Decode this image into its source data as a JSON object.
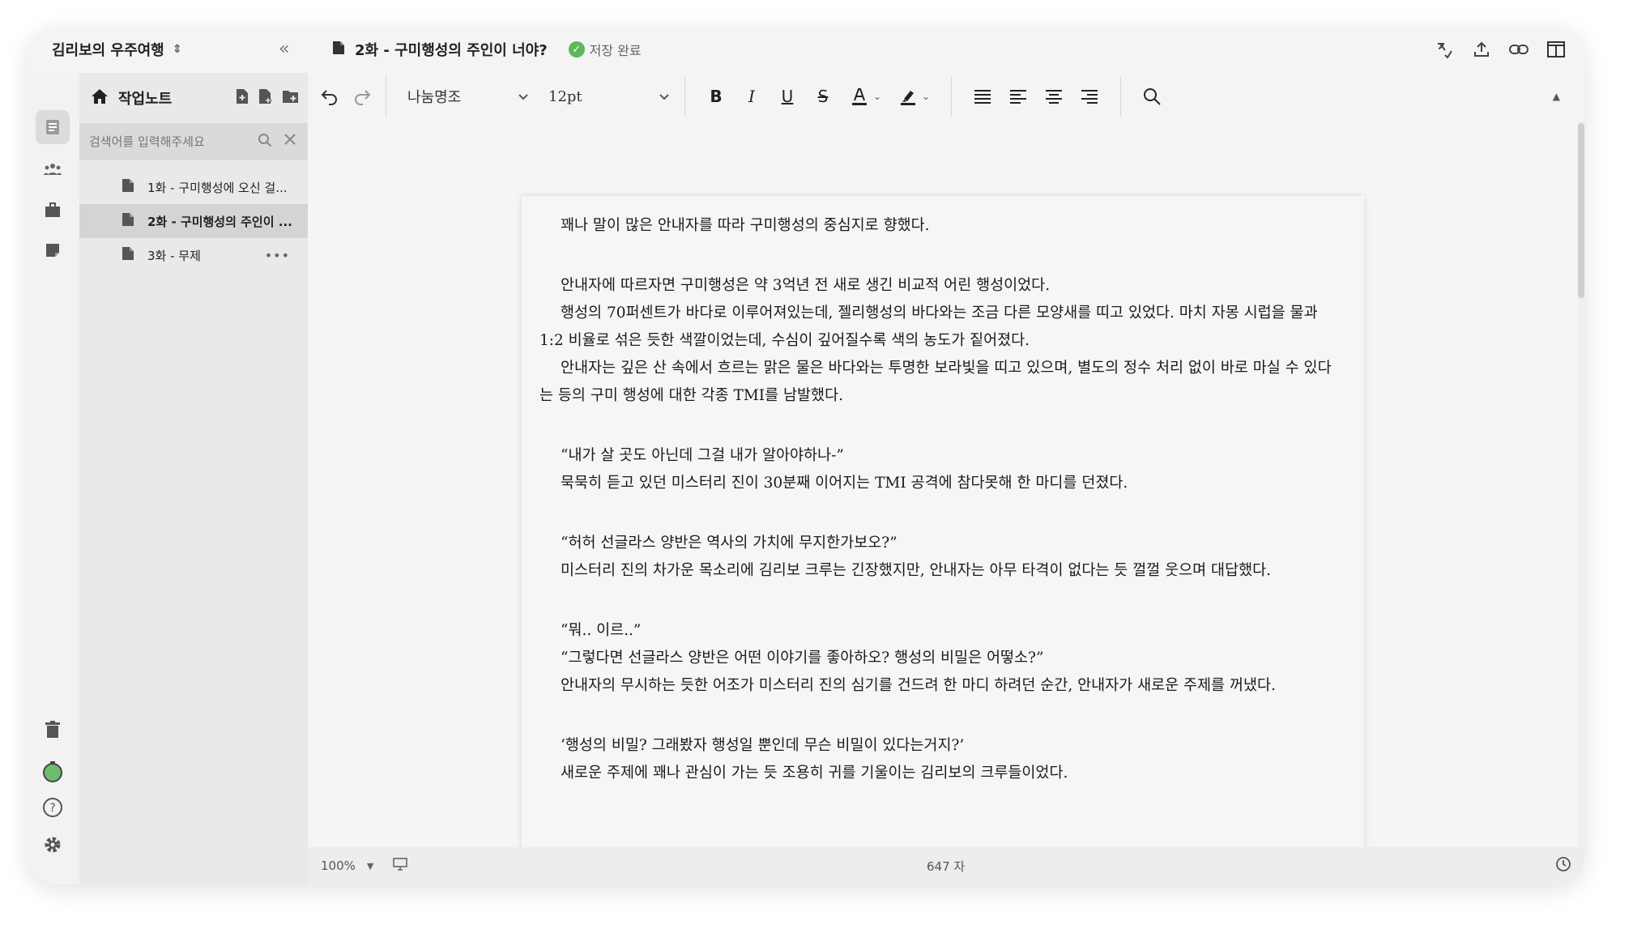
{
  "project": {
    "name": "김리보의 우주여행"
  },
  "document": {
    "title": "2화 - 구미행성의 주인이 너야?",
    "save_status": "저장 완료"
  },
  "sidebar": {
    "title": "작업노트",
    "search_placeholder": "검색어를 입력해주세요",
    "items": [
      {
        "label": "1화 - 구미행성에 오신 걸...",
        "active": false
      },
      {
        "label": "2화 - 구미행성의 주인이 ...",
        "active": true
      },
      {
        "label": "3화 - 무제",
        "active": false,
        "more": "•••"
      }
    ]
  },
  "toolbar": {
    "font": "나눔명조",
    "size": "12pt"
  },
  "body": [
    "꽤나 말이 많은 안내자를 따라 구미행성의 중심지로 향했다.",
    "",
    "안내자에 따르자면 구미행성은 약 3억년 전 새로 생긴  비교적 어린 행성이었다.",
    "행성의 70퍼센트가 바다로 이루어져있는데, 젤리행성의 바다와는 조금 다른 모양새를 띠고 있었다. 마치 자몽 시럽을 물과 1:2 비율로 섞은 듯한 색깔이었는데, 수심이 깊어질수록 색의 농도가 짙어졌다.",
    "안내자는 깊은 산 속에서 흐르는 맑은 물은 바다와는 투명한 보라빛을 띠고 있으며, 별도의 정수 처리 없이 바로 마실 수 있다는 등의 구미 행성에 대한 각종 TMI를 남발했다.",
    "",
    "“내가 살 곳도 아닌데 그걸 내가 알아야하나-”",
    "묵묵히 듣고 있던 미스터리 진이 30분째 이어지는 TMI 공격에 참다못해 한 마디를 던졌다.",
    "",
    "“허허 선글라스 양반은 역사의 가치에 무지한가보오?”",
    "미스터리 진의 차가운 목소리에 김리보 크루는 긴장했지만, 안내자는 아무 타격이 없다는 듯 껄껄 웃으며 대답했다.",
    "",
    "“뭐.. 이르..”",
    "“그렇다면 선글라스 양반은 어떤 이야기를 좋아하오? 행성의 비밀은 어떻소?”",
    "안내자의 무시하는 듯한 어조가 미스터리 진의 심기를 건드려 한 마디 하려던 순간, 안내자가 새로운 주제를 꺼냈다.",
    "",
    "‘행성의 비밀? 그래봤자 행성일 뿐인데 무슨 비밀이 있다는거지?’",
    "새로운 주제에 꽤나 관심이 가는 듯 조용히 귀를 기울이는 김리보의 크루들이었다."
  ],
  "status": {
    "zoom": "100%",
    "char_count": "647 자"
  },
  "colors": {
    "saved_check": "#5cb85c",
    "sidebar_active": "#d4d4d4"
  }
}
